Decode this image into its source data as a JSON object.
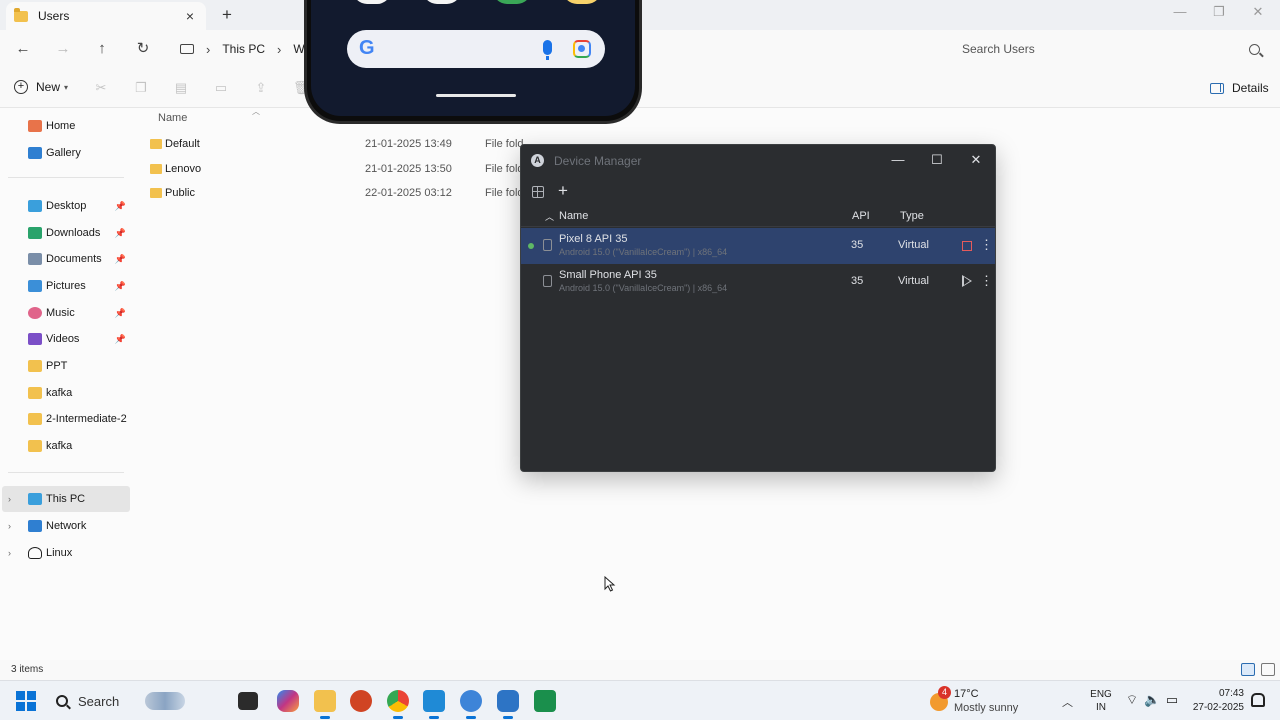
{
  "explorer": {
    "tab_title": "Users",
    "breadcrumb": [
      "This PC",
      "W"
    ],
    "search_placeholder": "Search Users",
    "toolbar": {
      "new_label": "New",
      "details_label": "Details"
    },
    "columns": {
      "name": "Name"
    },
    "files": [
      {
        "name": "Default",
        "date": "21-01-2025 13:49",
        "type": "File fold"
      },
      {
        "name": "Lenovo",
        "date": "21-01-2025 13:50",
        "type": "File fold"
      },
      {
        "name": "Public",
        "date": "22-01-2025 03:12",
        "type": "File fold"
      }
    ],
    "status_count": "3 items"
  },
  "sidebar": {
    "top": [
      {
        "label": "Home",
        "icon": "home-icon",
        "color": "#e8734a"
      },
      {
        "label": "Gallery",
        "icon": "gallery-icon",
        "color": "#2f7fd1"
      }
    ],
    "pinned": [
      {
        "label": "Desktop",
        "icon": "desktop-icon",
        "color": "#3a9fdc"
      },
      {
        "label": "Downloads",
        "icon": "download-icon",
        "color": "#2aa36b"
      },
      {
        "label": "Documents",
        "icon": "documents-icon",
        "color": "#7a8ea8"
      },
      {
        "label": "Pictures",
        "icon": "pictures-icon",
        "color": "#3b8fd8"
      },
      {
        "label": "Music",
        "icon": "music-icon",
        "color": "#e0648a"
      },
      {
        "label": "Videos",
        "icon": "videos-icon",
        "color": "#7b4fc7"
      }
    ],
    "folders": [
      {
        "label": "PPT"
      },
      {
        "label": "kafka"
      },
      {
        "label": "2-Intermediate-2"
      },
      {
        "label": "kafka"
      }
    ],
    "bottom": [
      {
        "label": "This PC",
        "icon": "this-pc-icon",
        "color": "#3a9fdc",
        "selected": true
      },
      {
        "label": "Network",
        "icon": "network-icon",
        "color": "#2f7fd1",
        "selected": false
      },
      {
        "label": "Linux",
        "icon": "linux-icon",
        "color": "#222222",
        "selected": false
      }
    ]
  },
  "device_manager": {
    "title": "Device Manager",
    "columns": {
      "name": "Name",
      "api": "API",
      "type": "Type"
    },
    "devices": [
      {
        "name": "Pixel 8 API 35",
        "detail": "Android 15.0 (\"VanillaIceCream\") | x86_64",
        "api": "35",
        "type": "Virtual",
        "running": true
      },
      {
        "name": "Small Phone API 35",
        "detail": "Android 15.0 (\"VanillaIceCream\") | x86_64",
        "api": "35",
        "type": "Virtual",
        "running": false
      }
    ]
  },
  "taskbar": {
    "search_label": "Search",
    "weather": {
      "badge": "4",
      "temp": "17°C",
      "condition": "Mostly sunny"
    },
    "lang": {
      "line1": "ENG",
      "line2": "IN"
    },
    "clock": {
      "time": "07:43",
      "date": "27-02-2025"
    }
  }
}
